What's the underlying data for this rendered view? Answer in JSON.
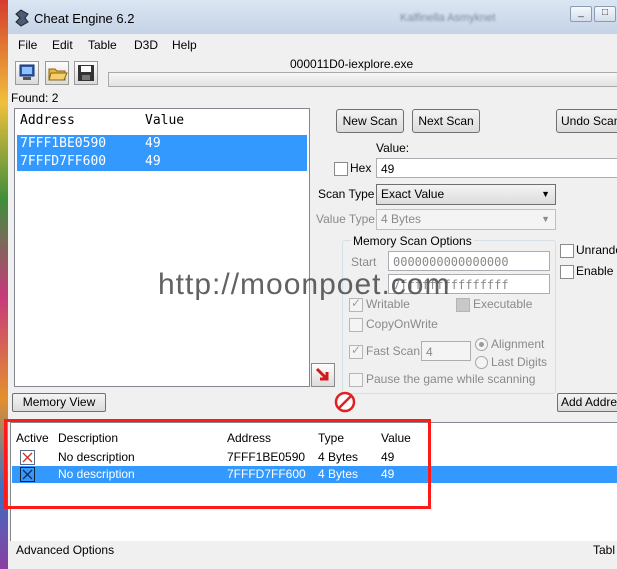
{
  "window": {
    "title": "Cheat Engine 6.2",
    "background_title": "Kalfinella Asmyknet",
    "buttons": [
      "_",
      "□",
      "×"
    ]
  },
  "menu": [
    "File",
    "Edit",
    "Table",
    "D3D",
    "Help"
  ],
  "toolbar": {
    "icons": [
      "process-select-icon",
      "open-folder-icon",
      "save-disk-icon"
    ]
  },
  "process": "000011D0-iexplore.exe",
  "found": "Found: 2",
  "results": {
    "headers": [
      "Address",
      "Value"
    ],
    "rows": [
      {
        "address": "7FFF1BE0590",
        "value": "49"
      },
      {
        "address": "7FFFD7FF600",
        "value": "49"
      }
    ]
  },
  "scan": {
    "new_scan": "New Scan",
    "next_scan": "Next Scan",
    "undo_scan": "Undo Scan",
    "value_label": "Value:",
    "hex_label": "Hex",
    "value": "49",
    "scan_type_label": "Scan Type",
    "scan_type": "Exact Value",
    "value_type_label": "Value Type",
    "value_type": "4 Bytes"
  },
  "options": {
    "title": "Memory Scan Options",
    "start_label": "Start",
    "start": "0000000000000000",
    "stop": "7fffffffffffffff",
    "writable": "Writable",
    "executable": "Executable",
    "copy_on_write": "CopyOnWrite",
    "fast_scan": "Fast Scan",
    "fast_scan_value": "4",
    "alignment": "Alignment",
    "last_digits": "Last Digits",
    "pause": "Pause the game while scanning",
    "unrandomizer": "Unrando",
    "enable": "Enable"
  },
  "watermark": "http://moonpoet.com",
  "memory_view": "Memory View",
  "add_address": "Add Address",
  "table": {
    "headers": [
      "Active",
      "Description",
      "Address",
      "Type",
      "Value"
    ],
    "rows": [
      {
        "description": "No description",
        "address": "7FFF1BE0590",
        "type": "4 Bytes",
        "value": "49"
      },
      {
        "description": "No description",
        "address": "7FFFD7FF600",
        "type": "4 Bytes",
        "value": "49"
      }
    ]
  },
  "status": {
    "advanced_options": "Advanced Options",
    "table_extras": "Tabl"
  },
  "colors": {
    "selection": "#3399ff",
    "highlight_box": "#ff1a1a",
    "stop_icon": "#e02020"
  }
}
